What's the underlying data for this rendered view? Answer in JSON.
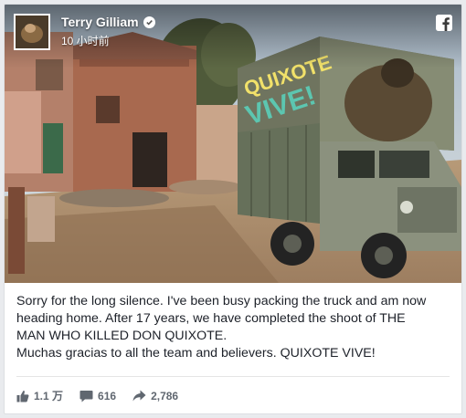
{
  "post": {
    "author": "Terry Gilliam",
    "timestamp": "10 小时前",
    "image": {
      "truck_sign_line1": "QUIXOTE",
      "truck_sign_line2": "VIVE!"
    },
    "text_lines": [
      "Sorry for the long silence. I've been busy packing the truck and am now",
      "heading home. After 17 years, we have completed the shoot of THE",
      "MAN WHO KILLED DON QUIXOTE.",
      "Muchas gracias to all the team and believers. QUIXOTE VIVE!"
    ]
  },
  "stats": {
    "likes": "1.1 万",
    "comments": "616",
    "shares": "2,786"
  },
  "icons": {
    "verified": "verified-check-icon",
    "brand": "facebook-logo-icon",
    "likes": "thumbs-up-icon",
    "comments": "comment-bubble-icon",
    "shares": "share-arrow-icon"
  },
  "colors": {
    "stat_text": "#606770",
    "post_text": "#1d2129",
    "sign_text": "#f1e16a",
    "truck_green": "#7a8069"
  }
}
